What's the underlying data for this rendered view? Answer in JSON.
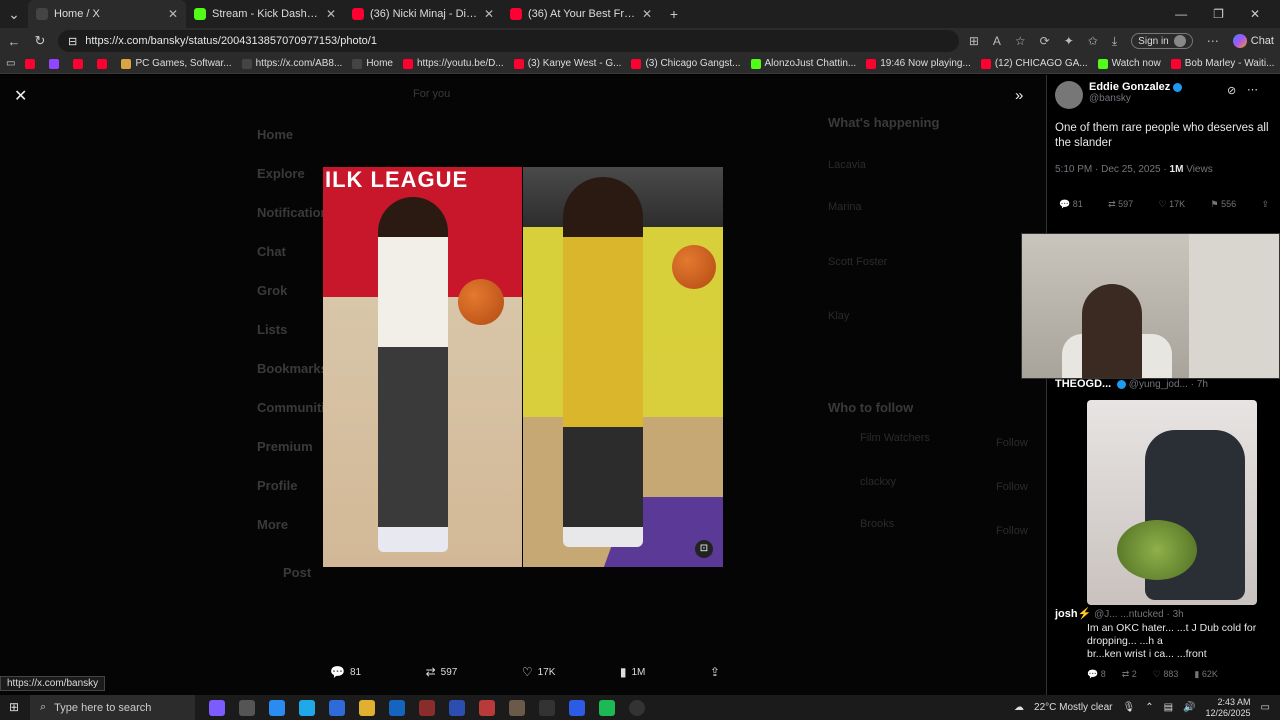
{
  "browser": {
    "tabs": [
      {
        "title": "Home / X",
        "color": "#444444"
      },
      {
        "title": "Stream - Kick Dashboard",
        "color": "#53fc18"
      },
      {
        "title": "(36) Nicki Minaj - Dirty Money (Fre",
        "color": "#ff0033"
      },
      {
        "title": "(36) At Your Best Frank Ocean - Yo",
        "color": "#ff0033"
      }
    ],
    "url": "https://x.com/bansky/status/2004313857070977153/photo/1",
    "sign_in": "Sign in",
    "chat": "Chat",
    "bookmarks": [
      {
        "label": "",
        "color": "#ff0033"
      },
      {
        "label": "",
        "color": "#9146ff"
      },
      {
        "label": "",
        "color": "#ff0033"
      },
      {
        "label": "",
        "color": "#ff0033"
      },
      {
        "label": "PC Games, Softwar...",
        "color": "#d9a441"
      },
      {
        "label": "https://x.com/AB8...",
        "color": "#444444"
      },
      {
        "label": "Home",
        "color": "#444444"
      },
      {
        "label": "https://youtu.be/D...",
        "color": "#ff0033"
      },
      {
        "label": "(3) Kanye West - G...",
        "color": "#ff0033"
      },
      {
        "label": "(3) Chicago Gangst...",
        "color": "#ff0033"
      },
      {
        "label": "AlonzoJust Chattin...",
        "color": "#53fc18"
      },
      {
        "label": "19:46 Now playing...",
        "color": "#ff0033"
      },
      {
        "label": "(12) CHICAGO GA...",
        "color": "#ff0033"
      },
      {
        "label": "Watch now",
        "color": "#53fc18"
      },
      {
        "label": "Bob Marley - Waiti...",
        "color": "#ff0033"
      }
    ]
  },
  "background": {
    "nav": [
      "Home",
      "Explore",
      "Notifications",
      "Chat",
      "Grok",
      "Lists",
      "Bookmarks",
      "Communities",
      "Premium",
      "Profile",
      "More"
    ],
    "post_button": "Post",
    "feed_tab": "For you",
    "whats_happening": "What's happening",
    "trends": [
      "Lacavia",
      "Marina",
      "Scott Foster",
      "Klay"
    ],
    "who_to_follow": "Who to follow",
    "follow_label": "Follow",
    "follow_people": [
      "Film Watchers",
      "clackxy",
      "Brooks"
    ]
  },
  "photo_bottom_bar": {
    "replies": "81",
    "reposts": "597",
    "likes": "17K",
    "views": "1M"
  },
  "post": {
    "author_name": "Eddie Gonzalez",
    "author_handle": "@bansky",
    "text": "One of them rare people who deserves all the slander",
    "time": "5:10 PM · Dec 25, 2025 ·",
    "views": "1M",
    "views_label": "Views",
    "replies": "81",
    "reposts": "597",
    "likes": "17K",
    "bookmarks": "556"
  },
  "reply_1": {
    "name": "THEOGD...",
    "handle": "@yung_jod...",
    "time": "· 7h"
  },
  "reply_2": {
    "name": "josh⚡",
    "handle": "@J... ...ntucked",
    "time": "· 3h",
    "text_lines": [
      "Im an OKC hater... ...t J Dub cold for",
      "dropping... ...h a",
      "br...ken wrist i ca... ...front"
    ],
    "replies": "8",
    "reposts": "2",
    "likes": "883",
    "views": "62K"
  },
  "status_url": "https://x.com/bansky",
  "photo": {
    "banner_text": "ILK LEAGUE"
  },
  "taskbar": {
    "search_placeholder": "Type here to search",
    "weather": "22°C  Mostly clear",
    "time": "2:43 AM",
    "date": "12/26/2025"
  }
}
